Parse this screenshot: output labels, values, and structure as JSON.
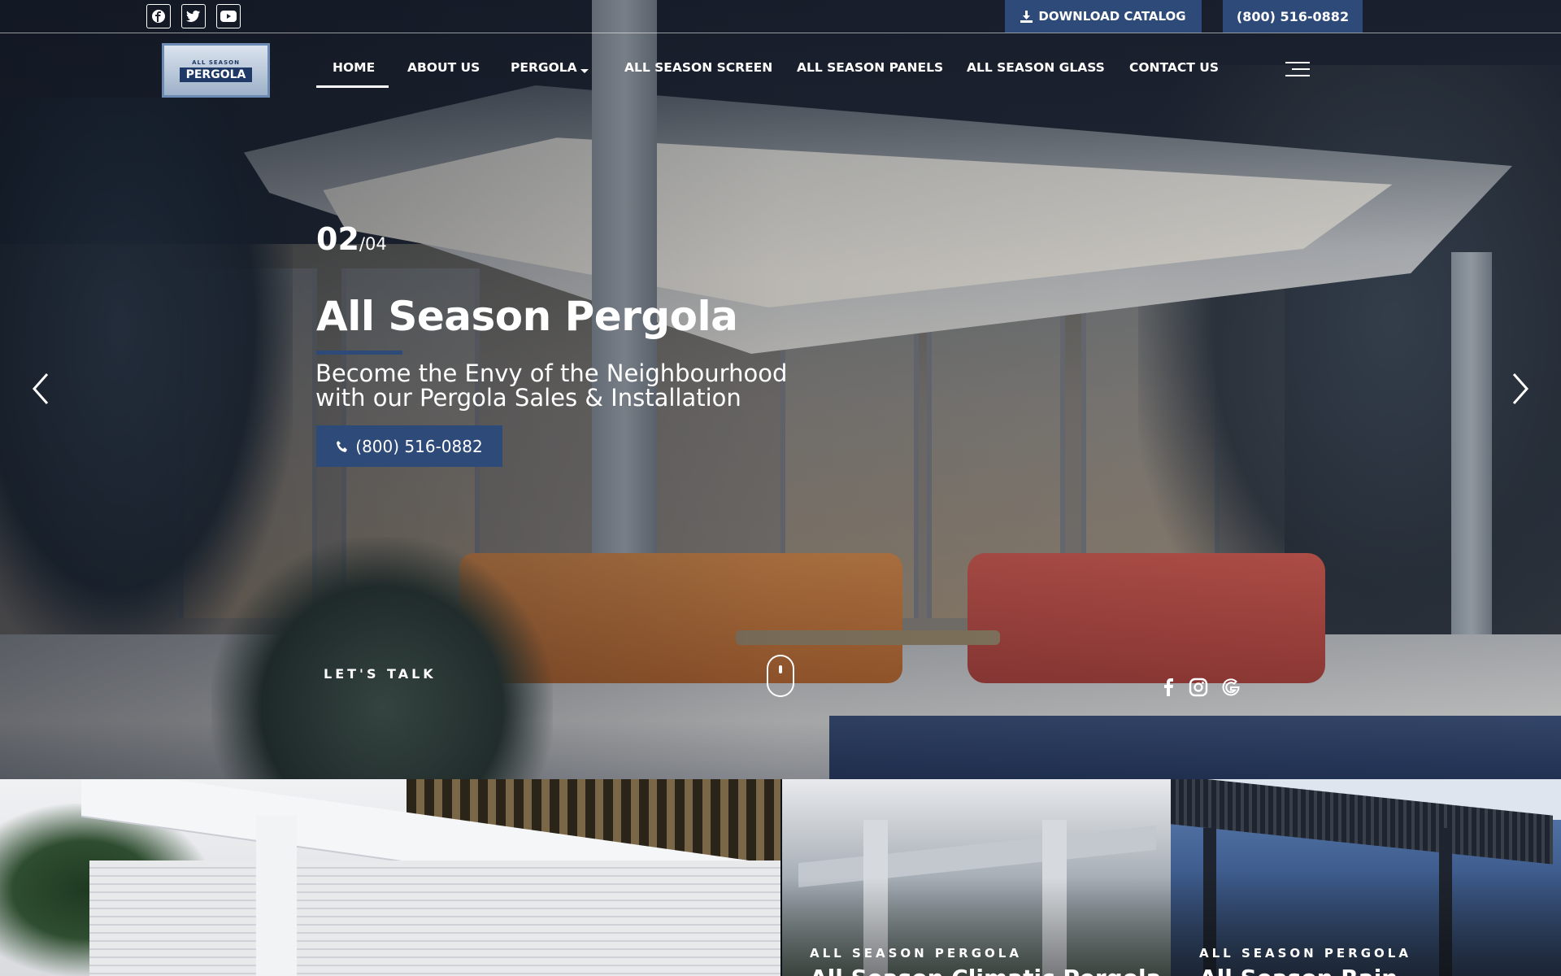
{
  "topbar": {
    "social": [
      {
        "name": "facebook",
        "glyph": "f"
      },
      {
        "name": "twitter",
        "glyph": "t"
      },
      {
        "name": "youtube",
        "glyph": "▶"
      }
    ],
    "catalog_label": "DOWNLOAD CATALOG",
    "phone_label": "(800) 516-0882"
  },
  "logo": {
    "small": "ALL SEASON",
    "big": "PERGOLA"
  },
  "nav": {
    "items": [
      {
        "label": "HOME",
        "active": true
      },
      {
        "label": "ABOUT US"
      },
      {
        "label": "PERGOLA",
        "dropdown": true
      },
      {
        "label": "ALL SEASON SCREEN"
      },
      {
        "label": "ALL SEASON PANELS"
      },
      {
        "label": "ALL SEASON GLASS"
      },
      {
        "label": "CONTACT US"
      }
    ]
  },
  "hero": {
    "slide_current": "02",
    "slide_total": "/04",
    "title": "All Season Pergola",
    "subtitle_line1": "Become the Envy of the Neighbourhood",
    "subtitle_line2": "with our Pergola Sales & Installation",
    "button_label": "(800) 516-0882",
    "lets_talk": "LET'S TALK",
    "social": [
      "f",
      "◎",
      "G"
    ]
  },
  "panels": [
    {
      "kicker": "",
      "title": ""
    },
    {
      "kicker": "ALL SEASON PERGOLA",
      "title": "All Season Climatic Pergola"
    },
    {
      "kicker": "ALL SEASON PERGOLA",
      "title": "All Season Rain"
    }
  ],
  "colors": {
    "accent": "#2e4a78",
    "text": "#ffffff"
  }
}
